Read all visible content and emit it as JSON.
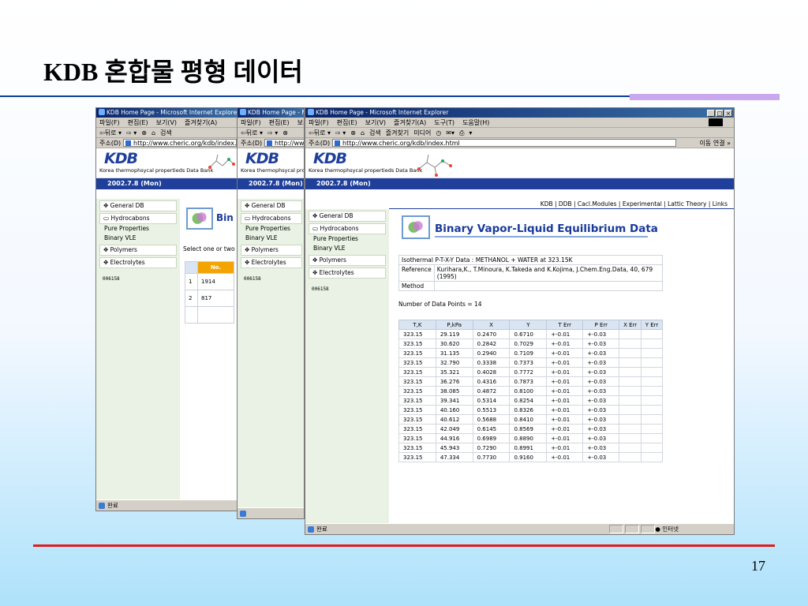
{
  "slide": {
    "title": "KDB 혼합물 평형 데이터",
    "page_number": "17"
  },
  "browser": {
    "window_title": "KDB Home Page - Microsoft Internet Explorer",
    "menu": [
      "파일(F)",
      "편집(E)",
      "보기(V)",
      "즐겨찾기(A)",
      "도구(T)",
      "도움말(H)"
    ],
    "toolbar": [
      "⇦뒤로 ▾",
      "⇨ ▾",
      "⊗",
      "⌂",
      "검색",
      "즐겨찾기",
      "미디어",
      "◷",
      "✉▾",
      "⎙",
      "▾"
    ],
    "address_label": "주소(D)",
    "url": "http://www.cheric.org/kdb/index.html",
    "go_label": "이동",
    "links_label": "연결 »",
    "status": "완료",
    "zone": "인터넷"
  },
  "site": {
    "logo": "KDB",
    "subtitle": "Korea thermophsycal propertieds Data Bank",
    "date": "2002.7.8 (Mon)",
    "nav_links": "KDB | DDB | Cacl.Modules | Experimental | Lattic Theory | Links",
    "sidebar": {
      "general_db": "✥ General DB",
      "hydrocarbons": "▭ Hydrocabons",
      "pure_properties": "Pure Properties",
      "binary_vle": "Binary VLE",
      "polymers": "✥ Polymers",
      "electrolytes": "✥ Electrolytes",
      "counter": "006158"
    }
  },
  "back_window": {
    "title_fragment": "Bin",
    "select_text": "Select one or two",
    "table_header": "No.",
    "rows": [
      {
        "idx": "1",
        "val": "1914"
      },
      {
        "idx": "2",
        "val": "817"
      }
    ]
  },
  "main": {
    "page_title": "Binary Vapor-Liquid Equilibrium Data",
    "data_line": "Isothermal P-T-X-Y Data : METHANOL + WATER at 323.15K",
    "reference_label": "Reference",
    "reference_text": "Kurihara,K., T.Minoura, K.Takeda and K.Kojima, J.Chem.Eng.Data, 40, 679 (1995)",
    "method_label": "Method",
    "method_value": "",
    "num_points": "Number of Data Points = 14",
    "columns": [
      "T,K",
      "P,kPa",
      "X",
      "Y",
      "T Err",
      "P Err",
      "X Err",
      "Y Err"
    ],
    "rows": [
      [
        "323.15",
        "29.119",
        "0.2470",
        "0.6710",
        "+-0.01",
        "+-0.03",
        "",
        ""
      ],
      [
        "323.15",
        "30.620",
        "0.2842",
        "0.7029",
        "+-0.01",
        "+-0.03",
        "",
        ""
      ],
      [
        "323.15",
        "31.135",
        "0.2940",
        "0.7109",
        "+-0.01",
        "+-0.03",
        "",
        ""
      ],
      [
        "323.15",
        "32.790",
        "0.3338",
        "0.7373",
        "+-0.01",
        "+-0.03",
        "",
        ""
      ],
      [
        "323.15",
        "35.321",
        "0.4028",
        "0.7772",
        "+-0.01",
        "+-0.03",
        "",
        ""
      ],
      [
        "323.15",
        "36.276",
        "0.4316",
        "0.7873",
        "+-0.01",
        "+-0.03",
        "",
        ""
      ],
      [
        "323.15",
        "38.085",
        "0.4872",
        "0.8100",
        "+-0.01",
        "+-0.03",
        "",
        ""
      ],
      [
        "323.15",
        "39.341",
        "0.5314",
        "0.8254",
        "+-0.01",
        "+-0.03",
        "",
        ""
      ],
      [
        "323.15",
        "40.160",
        "0.5513",
        "0.8326",
        "+-0.01",
        "+-0.03",
        "",
        ""
      ],
      [
        "323.15",
        "40.612",
        "0.5688",
        "0.8410",
        "+-0.01",
        "+-0.03",
        "",
        ""
      ],
      [
        "323.15",
        "42.049",
        "0.6145",
        "0.8569",
        "+-0.01",
        "+-0.03",
        "",
        ""
      ],
      [
        "323.15",
        "44.916",
        "0.6989",
        "0.8890",
        "+-0.01",
        "+-0.03",
        "",
        ""
      ],
      [
        "323.15",
        "45.943",
        "0.7290",
        "0.8991",
        "+-0.01",
        "+-0.03",
        "",
        ""
      ],
      [
        "323.15",
        "47.334",
        "0.7730",
        "0.9160",
        "+-0.01",
        "+-0.03",
        "",
        ""
      ]
    ]
  },
  "colors": {
    "title_blue": "#1a3a9a",
    "date_bar": "#1f3f9a",
    "bottom_rule": "#e21b1b",
    "accent_no": "#f4a400"
  }
}
